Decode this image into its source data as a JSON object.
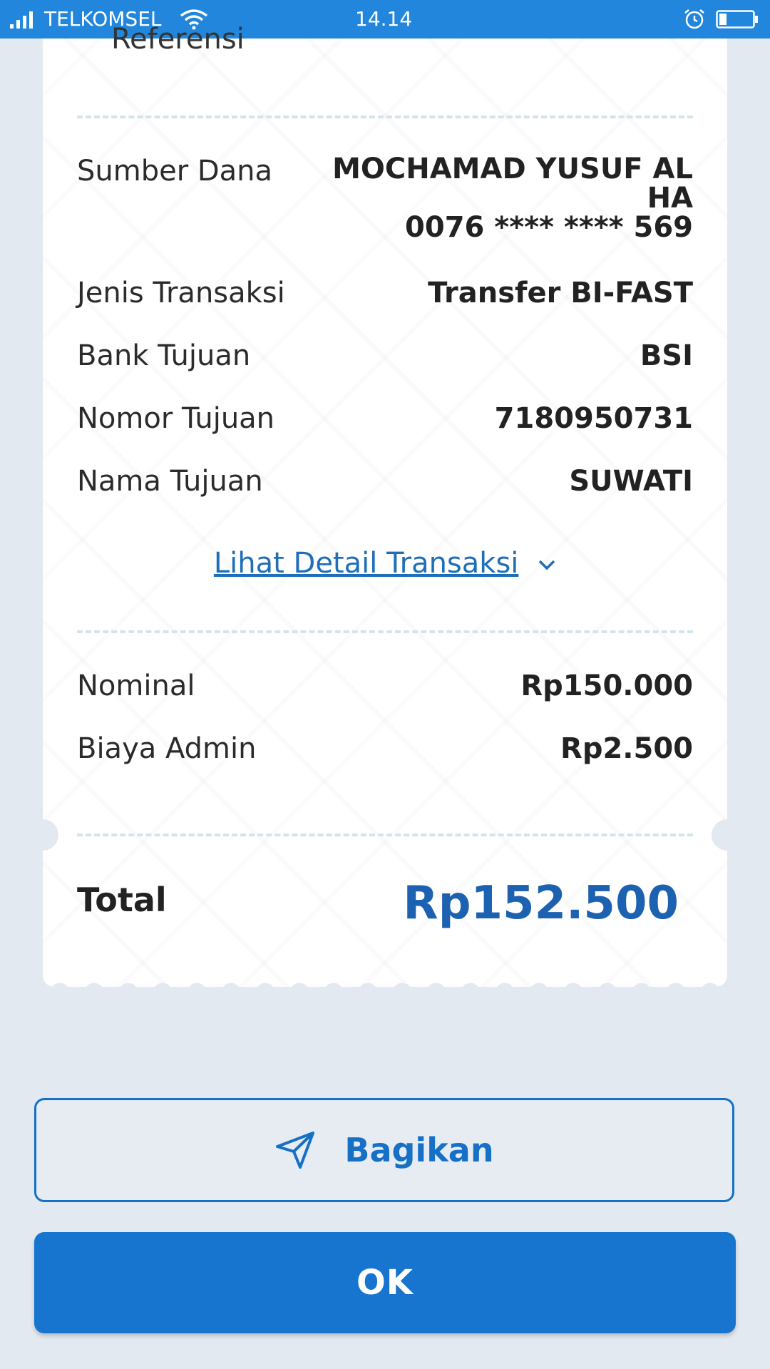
{
  "status_bar": {
    "carrier": "TELKOMSEL",
    "time": "14.14"
  },
  "receipt": {
    "reference_label": "Referensi",
    "rows": [
      {
        "label": "Sumber Dana",
        "value_lines": [
          "MOCHAMAD YUSUF AL",
          "HA",
          "0076 **** **** 569"
        ]
      },
      {
        "label": "Jenis Transaksi",
        "value": "Transfer BI-FAST"
      },
      {
        "label": "Bank Tujuan",
        "value": "BSI"
      },
      {
        "label": "Nomor Tujuan",
        "value": "7180950731"
      },
      {
        "label": "Nama Tujuan",
        "value": "SUWATI"
      }
    ],
    "detail_link": "Lihat Detail Transaksi",
    "amounts": [
      {
        "label": "Nominal",
        "value": "Rp150.000"
      },
      {
        "label": "Biaya Admin",
        "value": "Rp2.500"
      }
    ],
    "total_label": "Total",
    "total_value": "Rp152.500"
  },
  "actions": {
    "share_label": "Bagikan",
    "ok_label": "OK"
  },
  "colors": {
    "status_bar": "#2186dc",
    "accent": "#1570c6",
    "total_value": "#1d62b0",
    "background": "#e3e9f0"
  }
}
